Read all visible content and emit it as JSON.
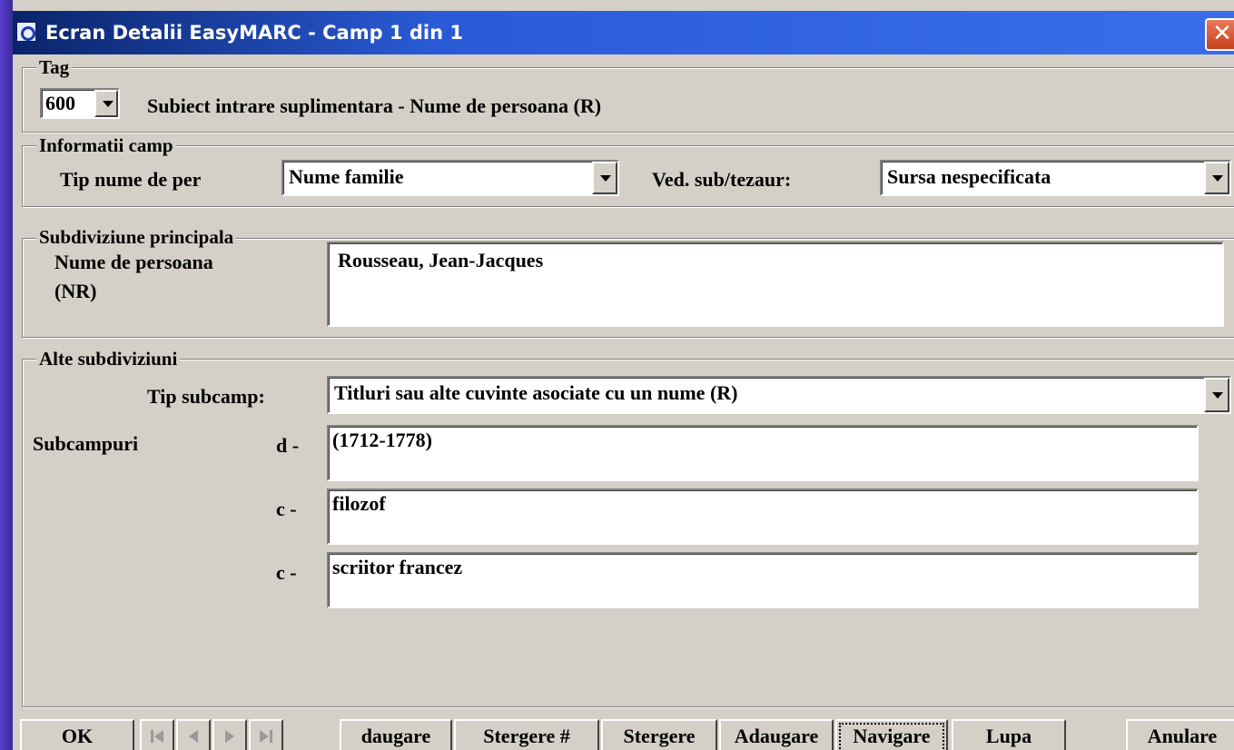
{
  "window": {
    "title": "Ecran Detalii EasyMARC - Camp 1 din 1"
  },
  "tag_group": {
    "legend": "Tag",
    "tag_value": "600",
    "description": "Subiect intrare suplimentara - Nume de persoana (R)"
  },
  "info_group": {
    "legend": "Informatii camp",
    "tip_label": "Tip nume de per",
    "tip_value": "Nume familie",
    "ved_label": "Ved. sub/tezaur:",
    "ved_value": "Sursa nespecificata"
  },
  "main_group": {
    "legend": "Subdiviziune principala",
    "label_line1": "Nume de persoana",
    "label_line2": "(NR)",
    "value": "Rousseau, Jean-Jacques"
  },
  "other_group": {
    "legend": "Alte subdiviziuni",
    "tip_subcamp_label": "Tip subcamp:",
    "tip_subcamp_value": "Titluri sau alte cuvinte asociate cu un nume (R)",
    "subcampuri_label": "Subcampuri",
    "subfields": [
      {
        "code": "d  -",
        "value": "(1712-1778)"
      },
      {
        "code": "c  -",
        "value": "filozof"
      },
      {
        "code": "c  -",
        "value": "scriitor francez"
      }
    ]
  },
  "buttons": {
    "ok": "OK",
    "adaugare1": "daugare",
    "stergere_hash": "Stergere #",
    "stergere": "Stergere",
    "adaugare2": "Adaugare",
    "navigare": "Navigare",
    "lupa": "Lupa",
    "anulare": "Anulare"
  },
  "icons": {
    "first": "first-record-icon",
    "prev": "previous-record-icon",
    "next": "next-record-icon",
    "last": "last-record-icon",
    "close": "close-icon"
  },
  "colors": {
    "titlebar": "#0a246a",
    "face": "#d4d0c8",
    "background": "#3a2a9a"
  }
}
